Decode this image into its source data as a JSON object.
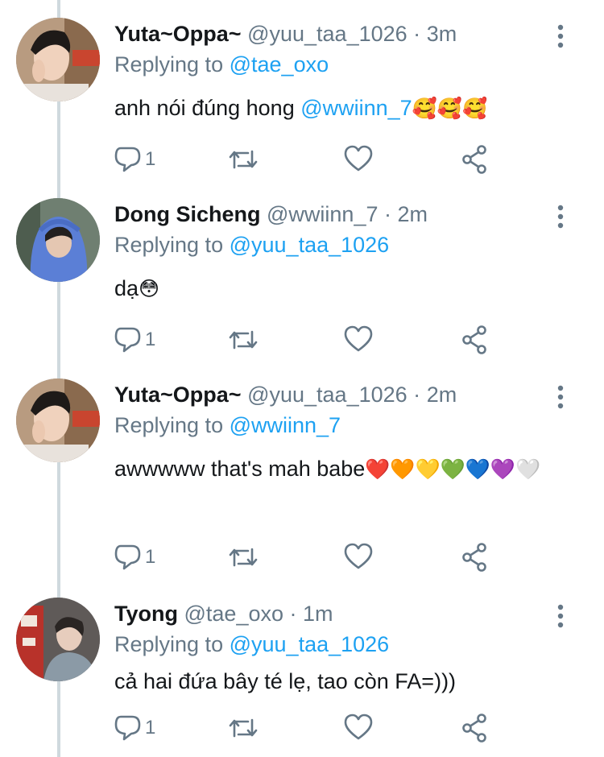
{
  "tweets": [
    {
      "name": "Yuta~Oppa~",
      "handle": "@yuu_taa_1026",
      "time": "3m",
      "replying_prefix": "Replying to",
      "replying_to": "@tae_oxo",
      "text": "anh nói đúng hong ",
      "mention": "@wwiinn_7",
      "emoji": "🥰🥰🥰",
      "reply_count": "1"
    },
    {
      "name": "Dong Sicheng",
      "handle": "@wwiinn_7",
      "time": "2m",
      "replying_prefix": "Replying to",
      "replying_to": "@yuu_taa_1026",
      "text": "dạ",
      "emoji": "😳",
      "reply_count": "1"
    },
    {
      "name": "Yuta~Oppa~",
      "handle": "@yuu_taa_1026",
      "time": "2m",
      "replying_prefix": "Replying to",
      "replying_to": "@wwiinn_7",
      "text": "awwwww that's mah babe",
      "emoji": "❤️🧡💛💚💙💜🤍",
      "reply_count": "1"
    },
    {
      "name": "Tyong",
      "handle": "@tae_oxo",
      "time": "1m",
      "replying_prefix": "Replying to",
      "replying_to": "@yuu_taa_1026",
      "text": "cả hai đứa bây té lẹ, tao còn FA=)))",
      "reply_count": "1"
    }
  ],
  "colors": {
    "link": "#1da1f2",
    "muted": "#657786",
    "text": "#14171a",
    "thread_line": "#cfd9de"
  },
  "icons": [
    "reply-icon",
    "retweet-icon",
    "like-icon",
    "share-icon",
    "more-options-icon"
  ]
}
